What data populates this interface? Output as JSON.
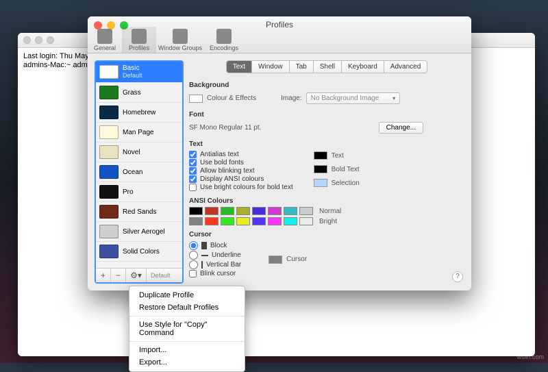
{
  "terminal": {
    "line1": "Last login: Thu May",
    "line2": "admins-Mac:~ admin$"
  },
  "window": {
    "title": "Profiles",
    "toolbar": [
      {
        "label": "General"
      },
      {
        "label": "Profiles"
      },
      {
        "label": "Window Groups"
      },
      {
        "label": "Encodings"
      }
    ]
  },
  "profiles": [
    {
      "name": "Basic",
      "sub": "Default",
      "bg": "#ffffff"
    },
    {
      "name": "Grass",
      "sub": "",
      "bg": "#1e7a1e"
    },
    {
      "name": "Homebrew",
      "sub": "",
      "bg": "#0a2a4a"
    },
    {
      "name": "Man Page",
      "sub": "",
      "bg": "#fef9d8"
    },
    {
      "name": "Novel",
      "sub": "",
      "bg": "#e9e2c0"
    },
    {
      "name": "Ocean",
      "sub": "",
      "bg": "#1453c6"
    },
    {
      "name": "Pro",
      "sub": "",
      "bg": "#111111"
    },
    {
      "name": "Red Sands",
      "sub": "",
      "bg": "#6f2a18"
    },
    {
      "name": "Silver Aerogel",
      "sub": "",
      "bg": "#cfcfcf"
    },
    {
      "name": "Solid Colors",
      "sub": "",
      "bg": "#3a4fa0"
    }
  ],
  "footer": {
    "add": "+",
    "remove": "−",
    "gear": "⚙︎▾",
    "default": "Default"
  },
  "tabs": [
    "Text",
    "Window",
    "Tab",
    "Shell",
    "Keyboard",
    "Advanced"
  ],
  "background": {
    "title": "Background",
    "colourEffects": "Colour & Effects",
    "imageLabel": "Image:",
    "imagePopup": "No Background Image"
  },
  "font": {
    "title": "Font",
    "desc": "SF Mono Regular 11 pt.",
    "change": "Change..."
  },
  "text": {
    "title": "Text",
    "antialias": "Antialias text",
    "bold": "Use bold fonts",
    "blink": "Allow blinking text",
    "ansi": "Display ANSI colours",
    "bright": "Use bright colours for bold text",
    "textLabel": "Text",
    "boldLabel": "Bold Text",
    "selLabel": "Selection"
  },
  "ansi": {
    "title": "ANSI Colours",
    "normal": "Normal",
    "bright": "Bright",
    "rowN": [
      "#000000",
      "#c23621",
      "#25bc24",
      "#adad27",
      "#492ee1",
      "#d338d3",
      "#33bbc8",
      "#cbcccd"
    ],
    "rowB": [
      "#818383",
      "#fc391f",
      "#31e722",
      "#eaec23",
      "#5833ff",
      "#f935f8",
      "#14f0f0",
      "#e9ebeb"
    ]
  },
  "cursor": {
    "title": "Cursor",
    "block": "Block",
    "under": "Underline",
    "bar": "Vertical Bar",
    "blink": "Blink cursor",
    "swatchLabel": "Cursor"
  },
  "menu": {
    "dup": "Duplicate Profile",
    "restore": "Restore Default Profiles",
    "style": "Use Style for \"Copy\" Command",
    "import": "Import...",
    "export": "Export..."
  },
  "watermark": "wsiin.com"
}
